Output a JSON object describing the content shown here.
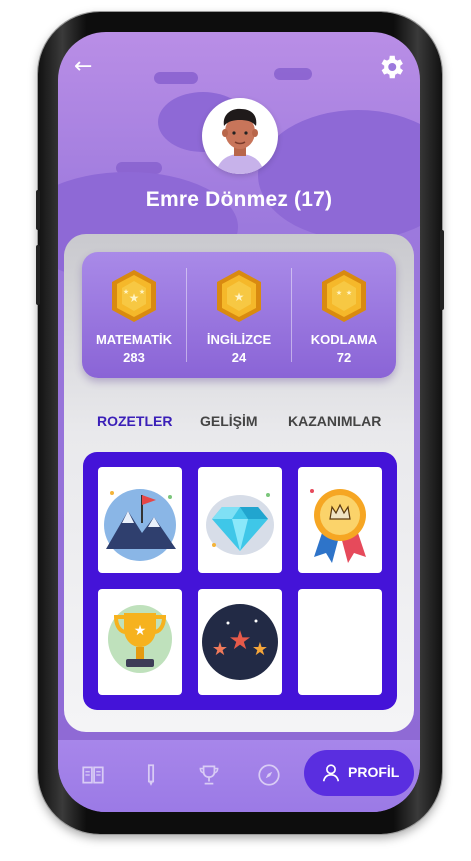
{
  "profile": {
    "name": "Emre Dönmez (17)"
  },
  "stats": [
    {
      "label": "MATEMATİK",
      "value": "283"
    },
    {
      "label": "İNGİLİZCE",
      "value": "24"
    },
    {
      "label": "KODLAMA",
      "value": "72"
    }
  ],
  "tabs": [
    {
      "label": "ROZETLER",
      "active": true
    },
    {
      "label": "GELİŞİM",
      "active": false
    },
    {
      "label": "KAZANIMLAR",
      "active": false
    }
  ],
  "badges": [
    "mountain-flag-icon",
    "diamond-icon",
    "award-rosette-icon",
    "trophy-icon",
    "stars-icon",
    "empty"
  ],
  "nav": {
    "items": [
      "book-icon",
      "pencil-icon",
      "trophy-icon",
      "compass-icon"
    ],
    "profile_label": "PROFİL"
  },
  "colors": {
    "accent": "#4413d8",
    "primary": "#8d68d4",
    "active_tab": "#3a1fb8"
  }
}
